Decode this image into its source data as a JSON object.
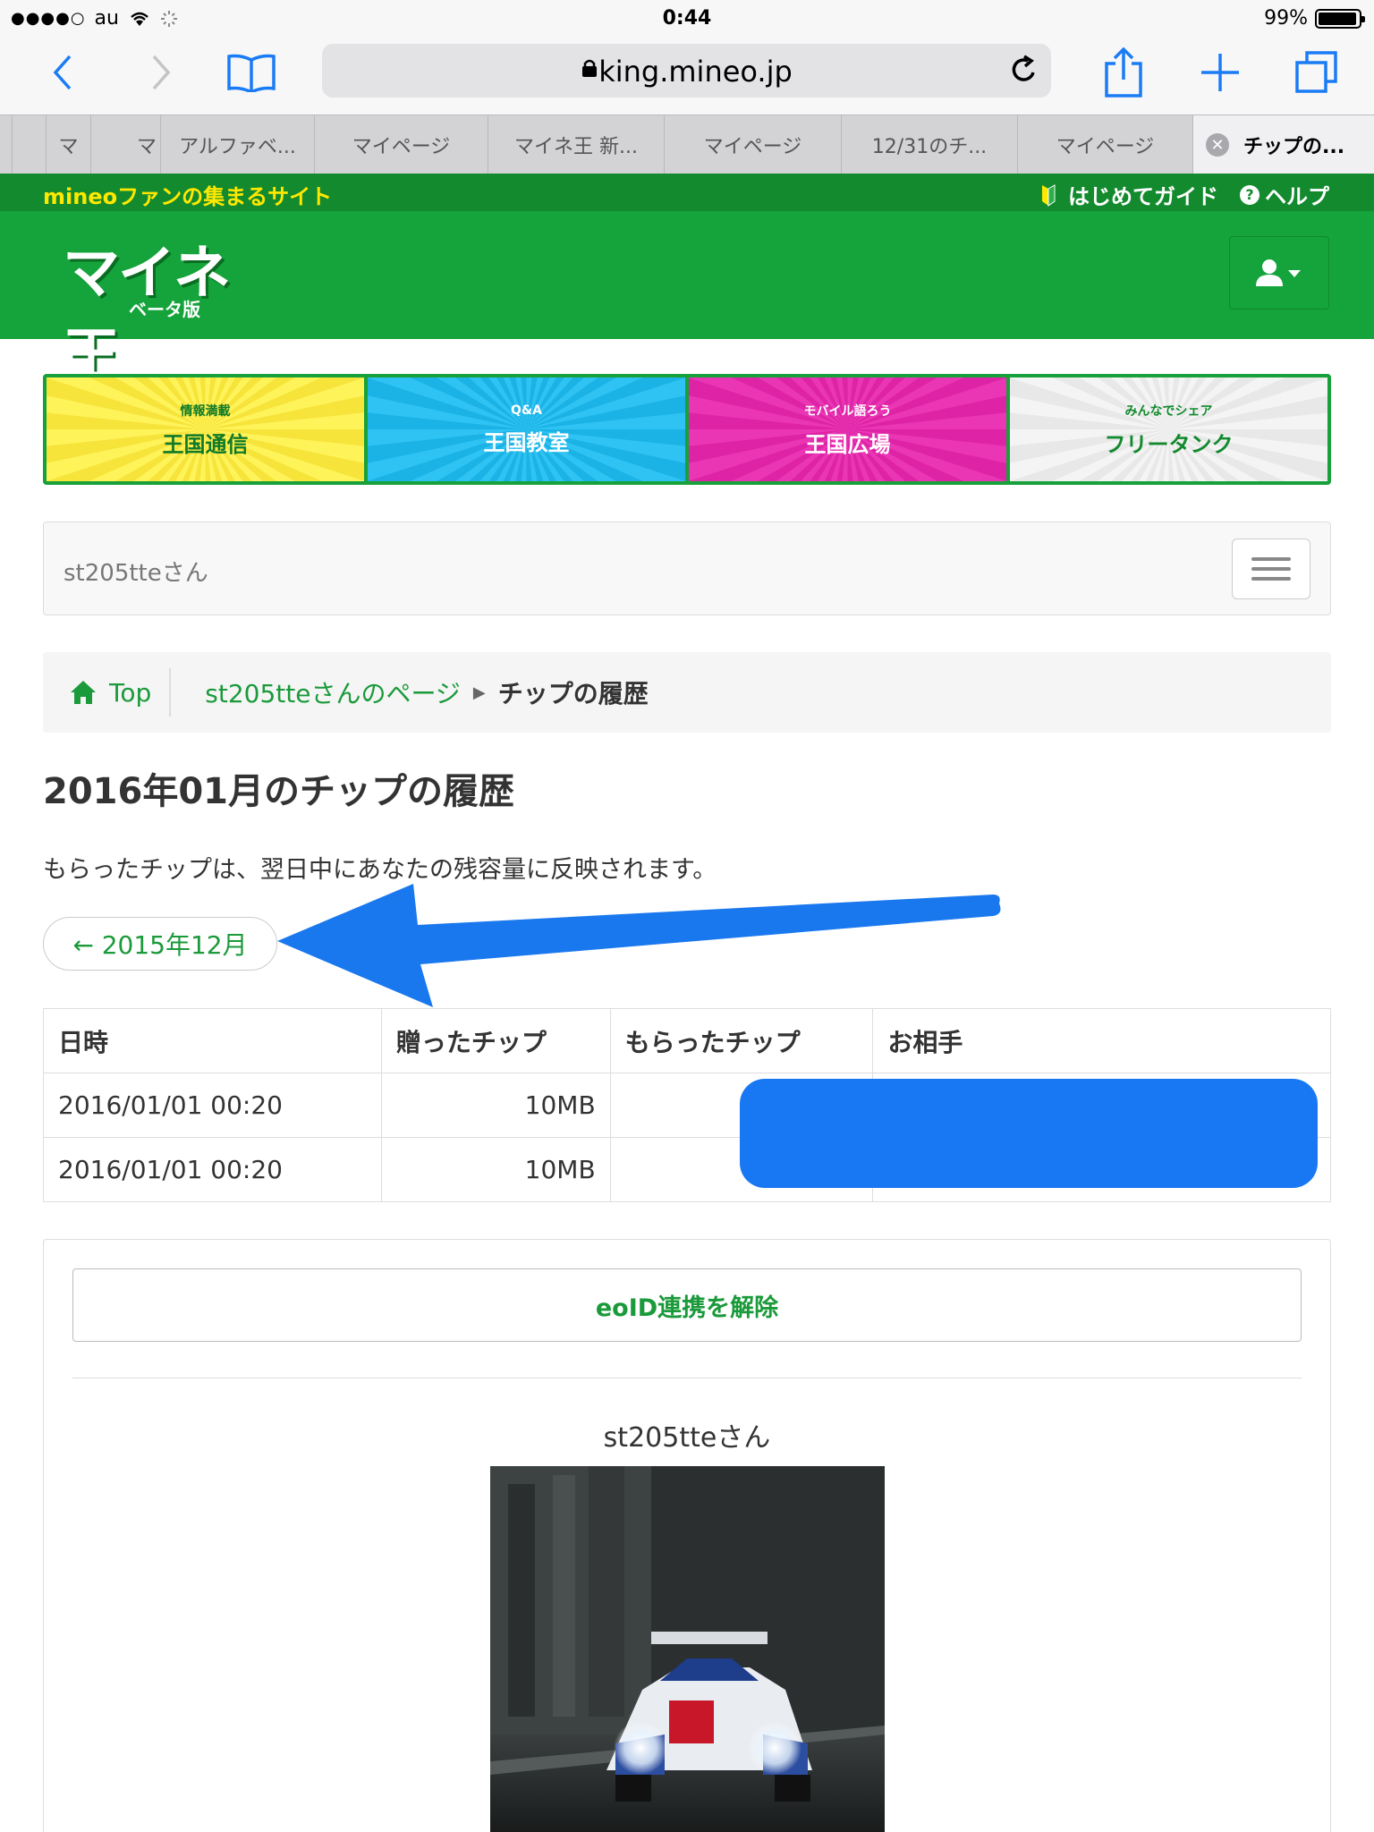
{
  "status_bar": {
    "signal": "●●●●○",
    "carrier": "au",
    "time": "0:44",
    "battery": "99%"
  },
  "browser": {
    "url": "king.mineo.jp",
    "tabs": [
      {
        "label": ""
      },
      {
        "label": ""
      },
      {
        "label": "マ"
      },
      {
        "label": "アルファベ..."
      },
      {
        "label": "マイページ"
      },
      {
        "label": "マイネ王 新..."
      },
      {
        "label": "マイページ"
      },
      {
        "label": "12/31のチ..."
      },
      {
        "label": "マイページ"
      },
      {
        "label": "チップの..."
      }
    ]
  },
  "site": {
    "tagline": "mineoファンの集まるサイト",
    "guide_link": "はじめてガイド",
    "help_link": "ヘルプ",
    "logo_text": "マイネ王",
    "logo_sub": "ベータ版"
  },
  "categories": [
    {
      "small": "情報満載",
      "big": "王国通信"
    },
    {
      "small": "Q&A",
      "big": "王国教室"
    },
    {
      "small": "モバイル語ろう",
      "big": "王国広場"
    },
    {
      "small": "みんなでシェア",
      "big": "フリータンク"
    }
  ],
  "user_nav": {
    "name": "st205tteさん"
  },
  "breadcrumb": {
    "home": "Top",
    "user_page": "st205tteさんのページ",
    "current": "チップの履歴"
  },
  "page": {
    "title": "2016年01月のチップの履歴",
    "note": "もらったチップは、翌日中にあなたの残容量に反映されます。",
    "prev_button": "← 2015年12月"
  },
  "table": {
    "headers": [
      "日時",
      "贈ったチップ",
      "もらったチップ",
      "お相手"
    ],
    "rows": [
      [
        "2016/01/01 00:20",
        "10MB",
        "",
        ""
      ],
      [
        "2016/01/01 00:20",
        "10MB",
        "",
        ""
      ]
    ]
  },
  "panel": {
    "eoid_button": "eoID連携を解除",
    "profile_name": "st205tteさん"
  },
  "colors": {
    "brand_green": "#15a33b",
    "link_green": "#1a9a3a",
    "annotation_blue": "#1877f2"
  }
}
